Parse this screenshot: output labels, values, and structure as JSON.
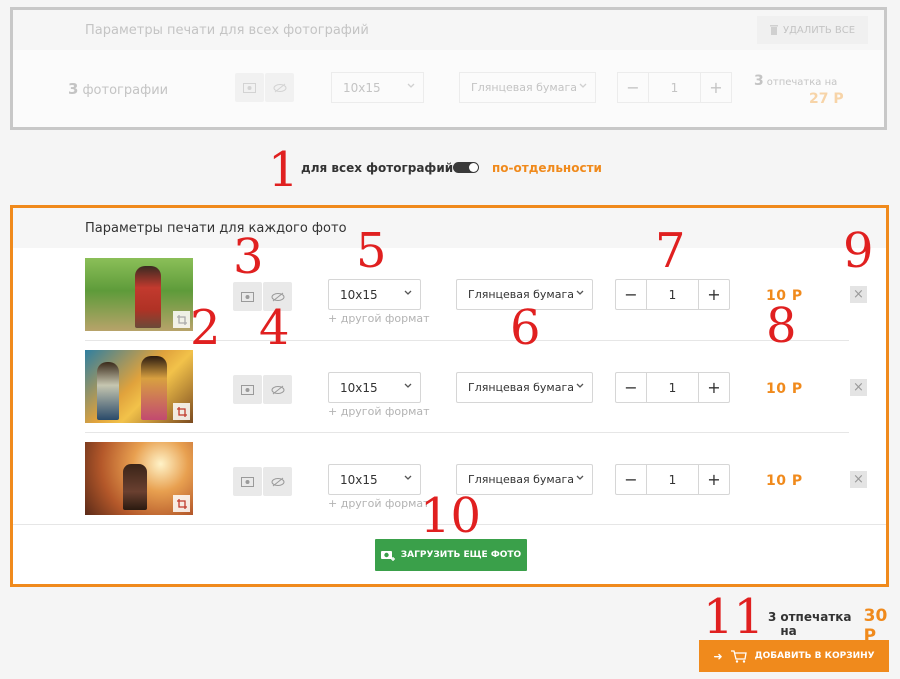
{
  "top_panel": {
    "header": "Параметры печати для всех фотографий",
    "delete_all": "УДАЛИТЬ ВСЕ",
    "count_num": "3",
    "count_label": "фотографии",
    "format": "10х15",
    "paper": "Глянцевая бумага",
    "qty": "1",
    "summary_num": "3",
    "summary_label": "отпечатка на",
    "summary_price": "27 Р"
  },
  "mode_toggle": {
    "all_label": "для всех фотографий",
    "individual_label": "по-отдельности"
  },
  "main_panel": {
    "header": "Параметры печати для каждого фото",
    "rows": [
      {
        "format": "10х15",
        "add_format": "+ другой формат",
        "paper": "Глянцевая бумага",
        "qty": "1",
        "price": "10 Р"
      },
      {
        "format": "10х15",
        "add_format": "+ другой формат",
        "paper": "Глянцевая бумага",
        "qty": "1",
        "price": "10 Р"
      },
      {
        "format": "10х15",
        "add_format": "+ другой формат",
        "paper": "Глянцевая бумага",
        "qty": "1",
        "price": "10 Р"
      }
    ],
    "upload_label": "ЗАГРУЗИТЬ ЕЩЕ ФОТО"
  },
  "footer": {
    "summary_count": "3",
    "summary_label": "отпечатка на",
    "summary_price": "30 Р",
    "cart_label": "ДОБАВИТЬ В КОРЗИНУ"
  },
  "annotations": [
    "1",
    "2",
    "3",
    "4",
    "5",
    "6",
    "7",
    "8",
    "9",
    "10",
    "11"
  ],
  "colors": {
    "accent": "#f08a1c",
    "green": "#3aa04a",
    "annotation": "#e02020"
  }
}
